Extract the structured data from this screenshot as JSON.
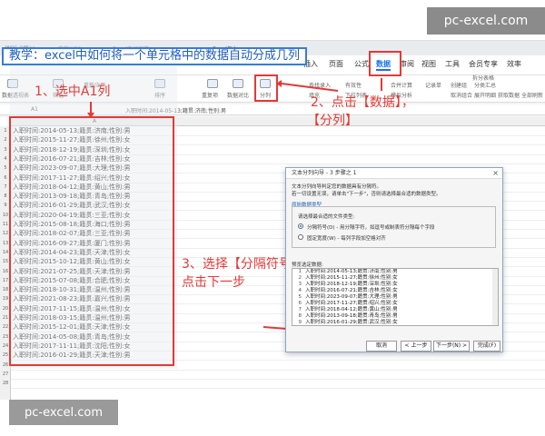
{
  "watermarks": {
    "top": "pc-excel.com",
    "bottom": "pc-excel.com"
  },
  "banner": "教学：excel中如何将一个单元格中的数据自动分成几列",
  "window_tabs": [
    "WPS Office",
    "我的WPS",
    "Excel中如何将...",
    "Excel怎么..."
  ],
  "menu": {
    "items": [
      "插入",
      "页面",
      "公式",
      "数据",
      "审阅",
      "视图",
      "工具",
      "会员专享",
      "效率"
    ],
    "active": "数据"
  },
  "ribbon": {
    "buttons": [
      "数据透视表",
      "筛选",
      "重新应用",
      "排序",
      "重复项",
      "数据对比",
      "分列",
      "填充",
      "查找录入",
      "有效性",
      "下拉列表",
      "合并计算",
      "模拟分析",
      "记录单",
      "创建组",
      "取消组合",
      "分类汇总",
      "展开明细",
      "拆分表格",
      "获取数据",
      "全部刷新"
    ]
  },
  "formula_bar": {
    "cell_ref": "A1",
    "value": "入职时间:2014-05-13;籍贯:济南;性别:男"
  },
  "grid": {
    "column_header": "A",
    "rows": [
      "入职时间:2014-05-13;籍贯:济南;性别:男",
      "入职时间:2015-11-27;籍贯:徐州;性别:女",
      "入职时间:2018-12-19;籍贯:深圳;性别:女",
      "入职时间:2016-07-21;籍贯:吉林;性别:女",
      "入职时间:2023-09-07;籍贯:大理;性别:男",
      "入职时间:2017-11-27;籍贯:绍兴;性别:女",
      "入职时间:2018-04-12;籍贯:黄山;性别:男",
      "入职时间:2013-09-18;籍贯:青岛;性别:男",
      "入职时间:2016-01-29;籍贯:武汉;性别:女",
      "入职时间:2020-04-19;籍贯:三亚;性别:女",
      "入职时间:2015-08-18;籍贯:海口;性别:男",
      "入职时间:2018-02-07;籍贯:三亚;性别:男",
      "入职时间:2016-09-27;籍贯:厦门;性别:男",
      "入职时间:2014-04-23;籍贯:天津;性别:女",
      "入职时间:2015-10-12;籍贯:黄山;性别:女",
      "入职时间:2021-07-25;籍贯:天津;性别:男",
      "入职时间:2015-07-08;籍贯:合肥;性别:女",
      "入职时间:2018-10-31;籍贯:温州;性别:男",
      "入职时间:2021-08-23;籍贯:嘉兴;性别:男",
      "入职时间:2017-11-15;籍贯:温州;性别:女",
      "入职时间:2018-03-15;籍贯:温州;性别:男",
      "入职时间:2015-12-01;籍贯:天津;性别:女",
      "入职时间:2014-05-08;籍贯:青岛;性别:女",
      "入职时间:2017-11-11;籍贯:沈阳;性别:女",
      "入职时间:2016-01-29;籍贯:天津;性别:男"
    ]
  },
  "annotations": {
    "step1": "1、选中A1列",
    "step2_line1": "2、点击【数据】，",
    "step2_line2": "【分列】",
    "step3_line1": "3、选择【分隔符号】",
    "step3_line2": "点击下一步"
  },
  "dialog": {
    "title": "文本分列向导 - 3 步骤之 1",
    "intro1": "文本分列向导判定您的数据具有分隔符。",
    "intro2": "若一切设置无误，请单击\"下一步\"，否则请选择最合适的数据类型。",
    "group_label": "原始数据类型",
    "group_prompt": "请选择最合适的文件类型:",
    "option1": "分隔符号(D) - 用分隔字符，如逗号或制表符分隔每个字段",
    "option2": "固定宽度(W) - 每列字段加空格对齐",
    "preview_label": "预览选定数据:",
    "preview_rows": [
      "入职时间:2014-05-13;籍贯:济南;性别:男",
      "入职时间:2015-11-27;籍贯:徐州;性别:女",
      "入职时间:2018-12-19;籍贯:深圳;性别:女",
      "入职时间:2016-07-21;籍贯:吉林;性别:女",
      "入职时间:2023-09-07;籍贯:大理;性别:男",
      "入职时间:2017-11-27;籍贯:绍兴;性别:女",
      "入职时间:2018-04-12;籍贯:黄山;性别:男",
      "入职时间:2013-09-18;籍贯:青岛;性别:男",
      "入职时间:2016-01-29;籍贯:武汉;性别:女"
    ],
    "buttons": {
      "cancel": "取消",
      "back": "< 上一步",
      "next": "下一步(N) >",
      "finish": "完成(F)"
    }
  },
  "colors": {
    "annotation_red": "#e53935",
    "banner_blue": "#1e5fbf",
    "accent": "#1a73e8"
  }
}
